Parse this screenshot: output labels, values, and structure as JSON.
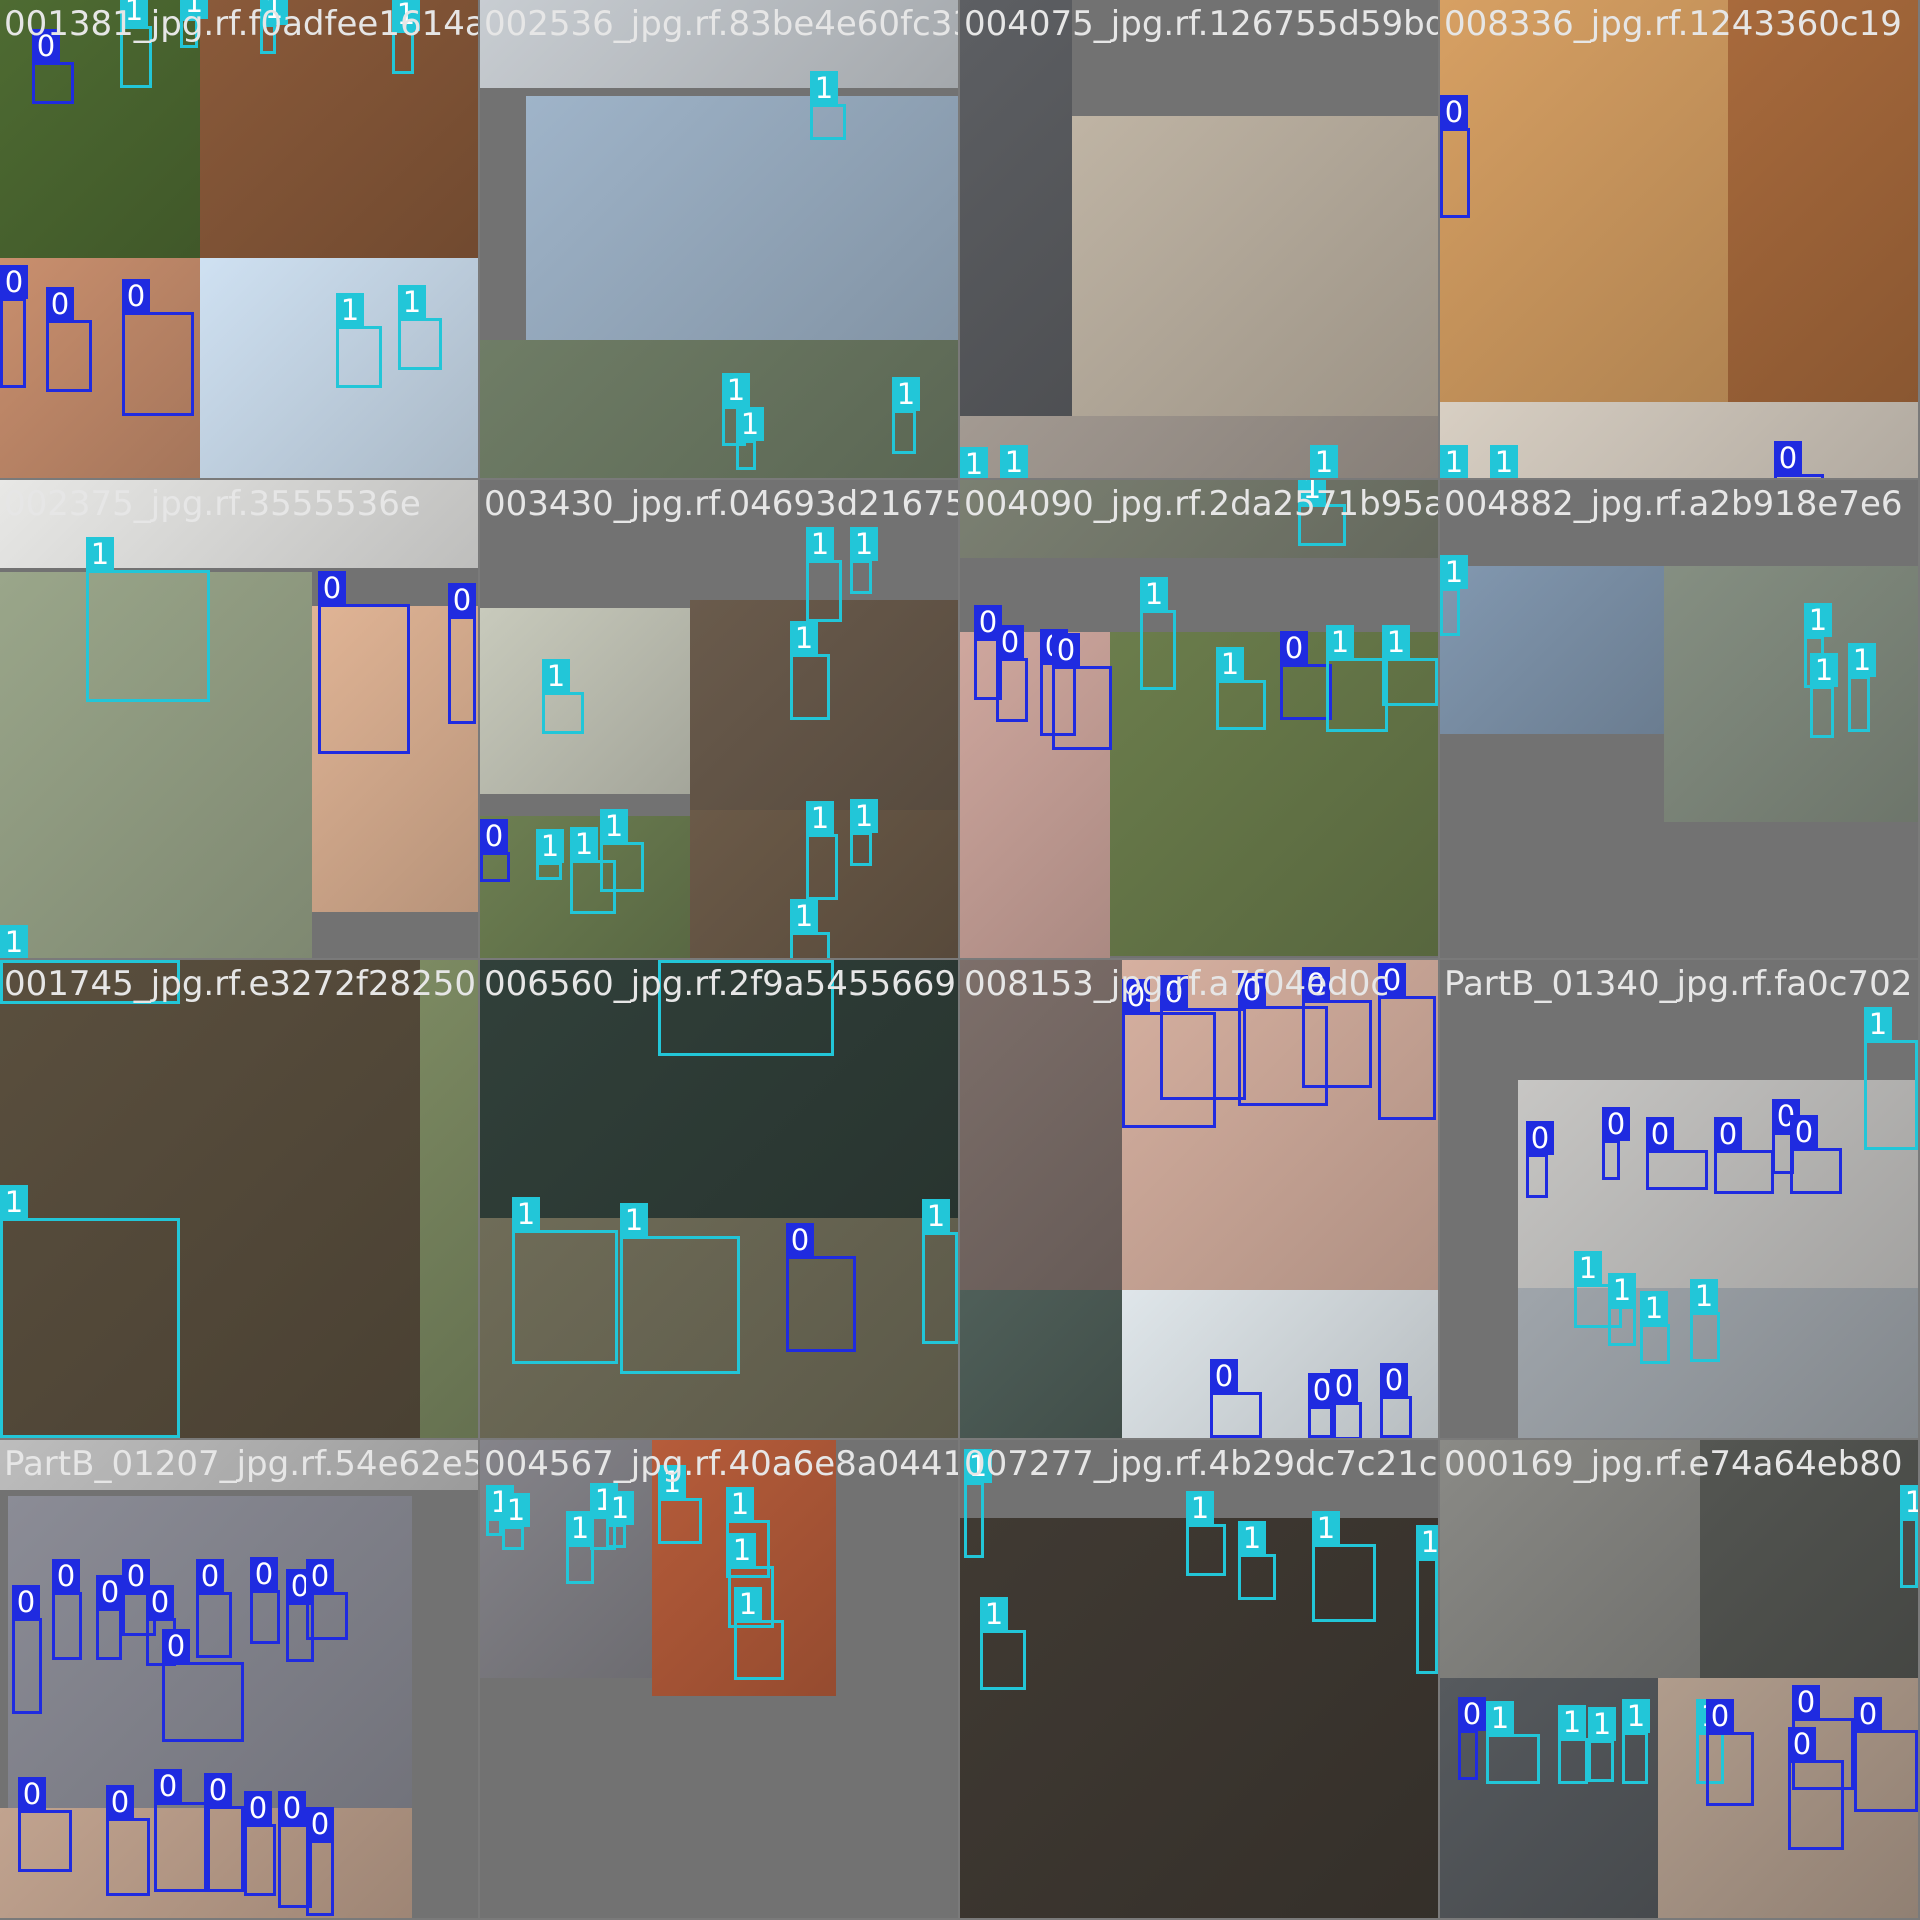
{
  "classes": {
    "0": {
      "color": "#1f2be0"
    },
    "1": {
      "color": "#22c6d8"
    }
  },
  "tiles": [
    {
      "filename": "001381_jpg.rf.f0adfee1614a2c0",
      "boxes": [
        {
          "cls": "0",
          "label": "0"
        },
        {
          "cls": "1",
          "label": "1"
        },
        {
          "cls": "1",
          "label": "1"
        },
        {
          "cls": "1",
          "label": "1"
        },
        {
          "cls": "1",
          "label": "1"
        },
        {
          "cls": "0",
          "label": "0"
        },
        {
          "cls": "0",
          "label": "0"
        },
        {
          "cls": "0",
          "label": "0"
        },
        {
          "cls": "1",
          "label": "1"
        },
        {
          "cls": "1",
          "label": "1"
        }
      ]
    },
    {
      "filename": "002536_jpg.rf.83be4e60fc33d0e",
      "boxes": [
        {
          "cls": "1",
          "label": "1"
        },
        {
          "cls": "1",
          "label": "1"
        },
        {
          "cls": "1",
          "label": "1"
        },
        {
          "cls": "1",
          "label": "1"
        }
      ]
    },
    {
      "filename": "004075_jpg.rf.126755d59bdc",
      "boxes": [
        {
          "cls": "1",
          "label": "1"
        },
        {
          "cls": "1",
          "label": "1"
        },
        {
          "cls": "1",
          "label": "1"
        }
      ]
    },
    {
      "filename": "008336_jpg.rf.1243360c19",
      "boxes": [
        {
          "cls": "0",
          "label": "0"
        },
        {
          "cls": "1",
          "label": "1"
        },
        {
          "cls": "1",
          "label": "1"
        },
        {
          "cls": "0",
          "label": "0"
        }
      ]
    },
    {
      "filename": "002375_jpg.rf.3555536e",
      "boxes": [
        {
          "cls": "1",
          "label": "1"
        },
        {
          "cls": "0",
          "label": "0"
        },
        {
          "cls": "0",
          "label": "0"
        },
        {
          "cls": "1",
          "label": "1"
        }
      ]
    },
    {
      "filename": "003430_jpg.rf.04693d21675",
      "boxes": [
        {
          "cls": "1",
          "label": "1"
        },
        {
          "cls": "1",
          "label": "1"
        },
        {
          "cls": "1",
          "label": "1"
        },
        {
          "cls": "1",
          "label": "1"
        },
        {
          "cls": "0",
          "label": "0"
        },
        {
          "cls": "1",
          "label": "1"
        },
        {
          "cls": "1",
          "label": "1"
        },
        {
          "cls": "1",
          "label": "1"
        },
        {
          "cls": "1",
          "label": "1"
        },
        {
          "cls": "1",
          "label": "1"
        },
        {
          "cls": "1",
          "label": "1"
        }
      ]
    },
    {
      "filename": "004090_jpg.rf.2da2571b95afa",
      "boxes": [
        {
          "cls": "1",
          "label": "1"
        },
        {
          "cls": "0",
          "label": "0"
        },
        {
          "cls": "0",
          "label": "0"
        },
        {
          "cls": "0",
          "label": "0"
        },
        {
          "cls": "0",
          "label": "0"
        },
        {
          "cls": "1",
          "label": "1"
        },
        {
          "cls": "1",
          "label": "1"
        },
        {
          "cls": "0",
          "label": "0"
        },
        {
          "cls": "1",
          "label": "1"
        },
        {
          "cls": "1",
          "label": "1"
        }
      ]
    },
    {
      "filename": "004882_jpg.rf.a2b918e7e6",
      "boxes": [
        {
          "cls": "1",
          "label": "1"
        },
        {
          "cls": "1",
          "label": "1"
        },
        {
          "cls": "1",
          "label": "1"
        },
        {
          "cls": "1",
          "label": "1"
        }
      ]
    },
    {
      "filename": "001745_jpg.rf.e3272f28250e",
      "boxes": [
        {
          "cls": "1",
          "label": "1"
        },
        {
          "cls": "1",
          "label": "1"
        }
      ]
    },
    {
      "filename": "006560_jpg.rf.2f9a5455669",
      "boxes": [
        {
          "cls": "1",
          "label": "1"
        },
        {
          "cls": "1",
          "label": "1"
        },
        {
          "cls": "1",
          "label": "1"
        },
        {
          "cls": "0",
          "label": "0"
        },
        {
          "cls": "1",
          "label": "1"
        }
      ]
    },
    {
      "filename": "008153_jpg.rf.a7f04ed0c",
      "boxes": [
        {
          "cls": "0",
          "label": "0"
        },
        {
          "cls": "0",
          "label": "0"
        },
        {
          "cls": "0",
          "label": "0"
        },
        {
          "cls": "0",
          "label": "0"
        },
        {
          "cls": "0",
          "label": "0"
        },
        {
          "cls": "0",
          "label": "0"
        },
        {
          "cls": "0",
          "label": "0"
        },
        {
          "cls": "0",
          "label": "0"
        },
        {
          "cls": "0",
          "label": "0"
        }
      ]
    },
    {
      "filename": "PartB_01340_jpg.rf.fa0c702",
      "boxes": [
        {
          "cls": "0",
          "label": "0"
        },
        {
          "cls": "0",
          "label": "0"
        },
        {
          "cls": "0",
          "label": "0"
        },
        {
          "cls": "0",
          "label": "0"
        },
        {
          "cls": "0",
          "label": "0"
        },
        {
          "cls": "0",
          "label": "0"
        },
        {
          "cls": "1",
          "label": "1"
        },
        {
          "cls": "1",
          "label": "1"
        },
        {
          "cls": "1",
          "label": "1"
        },
        {
          "cls": "1",
          "label": "1"
        },
        {
          "cls": "1",
          "label": "1"
        }
      ]
    },
    {
      "filename": "PartB_01207_jpg.rf.54e62e5",
      "boxes": [
        {
          "cls": "0",
          "label": "0"
        },
        {
          "cls": "0",
          "label": "0"
        },
        {
          "cls": "0",
          "label": "0"
        },
        {
          "cls": "0",
          "label": "0"
        },
        {
          "cls": "0",
          "label": "0"
        },
        {
          "cls": "0",
          "label": "0"
        },
        {
          "cls": "0",
          "label": "0"
        },
        {
          "cls": "0",
          "label": "0"
        },
        {
          "cls": "0",
          "label": "0"
        },
        {
          "cls": "0",
          "label": "0"
        },
        {
          "cls": "0",
          "label": "0"
        },
        {
          "cls": "0",
          "label": "0"
        },
        {
          "cls": "0",
          "label": "0"
        },
        {
          "cls": "0",
          "label": "0"
        },
        {
          "cls": "0",
          "label": "0"
        },
        {
          "cls": "0",
          "label": "0"
        },
        {
          "cls": "0",
          "label": "0"
        }
      ]
    },
    {
      "filename": "004567_jpg.rf.40a6e8a0441",
      "boxes": [
        {
          "cls": "1",
          "label": "1"
        },
        {
          "cls": "1",
          "label": "1"
        },
        {
          "cls": "1",
          "label": "1"
        },
        {
          "cls": "1",
          "label": "1"
        },
        {
          "cls": "1",
          "label": "1"
        },
        {
          "cls": "1",
          "label": "1"
        },
        {
          "cls": "1",
          "label": "1"
        },
        {
          "cls": "1",
          "label": "1"
        },
        {
          "cls": "1",
          "label": "1"
        }
      ]
    },
    {
      "filename": "007277_jpg.rf.4b29dc7c21c",
      "boxes": [
        {
          "cls": "1",
          "label": "1"
        },
        {
          "cls": "1",
          "label": "1"
        },
        {
          "cls": "1",
          "label": "1"
        },
        {
          "cls": "1",
          "label": "1"
        },
        {
          "cls": "1",
          "label": "1"
        },
        {
          "cls": "1",
          "label": "1"
        }
      ]
    },
    {
      "filename": "000169_jpg.rf.e74a64eb80",
      "boxes": [
        {
          "cls": "1",
          "label": "1"
        },
        {
          "cls": "0",
          "label": "0"
        },
        {
          "cls": "1",
          "label": "1"
        },
        {
          "cls": "1",
          "label": "1"
        },
        {
          "cls": "1",
          "label": "1"
        },
        {
          "cls": "1",
          "label": "1"
        },
        {
          "cls": "1",
          "label": "1"
        },
        {
          "cls": "0",
          "label": "0"
        },
        {
          "cls": "0",
          "label": "0"
        },
        {
          "cls": "0",
          "label": "0"
        },
        {
          "cls": "0",
          "label": "0"
        }
      ]
    }
  ]
}
